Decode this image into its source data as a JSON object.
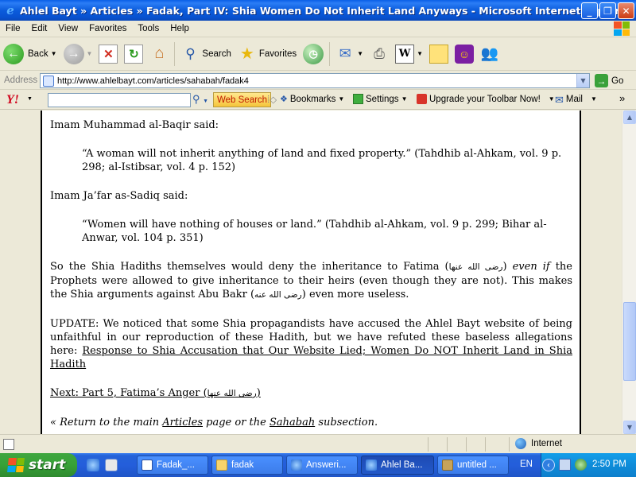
{
  "window": {
    "title": "Ahlel Bayt » Articles » Fadak, Part IV: Shia Women Do Not Inherit Land Anyways - Microsoft Internet Explorer",
    "minimize": "_",
    "maximize": "❐",
    "close": "✕"
  },
  "menu": {
    "items": [
      "File",
      "Edit",
      "View",
      "Favorites",
      "Tools",
      "Help"
    ]
  },
  "toolbar": {
    "back_label": "Back",
    "search_label": "Search",
    "favorites_label": "Favorites"
  },
  "address": {
    "label": "Address",
    "url": "http://www.ahlelbayt.com/articles/sahabah/fadak4",
    "go_label": "Go"
  },
  "yahoo": {
    "logo": "Y!",
    "search_button": "Web Search",
    "bookmarks": "Bookmarks",
    "settings": "Settings",
    "upgrade": "Upgrade your Toolbar Now!",
    "mail": "Mail",
    "more": "»"
  },
  "article": {
    "baqir_intro": "Imam Muhammad al-Baqir said:",
    "baqir_quote": "“A woman will not inherit anything of land and fixed property.” (Tahdhib al-Ahkam, vol. 9 p. 298; al-Istibsar, vol. 4 p. 152)",
    "sadiq_intro": "Imam Ja’far as-Sadiq said:",
    "sadiq_quote": "“Women will have nothing of houses or land.” (Tahdhib al-Ahkam, vol. 9 p. 299; Bihar al-Anwar, vol. 104 p. 351)",
    "p1_a": "So the Shia Hadiths themselves would deny the inheritance to Fatima (",
    "honorific_fatima": "رضی الله عنها",
    "p1_b": ") ",
    "p1_even_if": "even if",
    "p1_c": " the Prophets were allowed to give inheritance to their heirs (even though they are not). This makes the Shia arguments against Abu Bakr (",
    "honorific_abubakr": "رضی الله عنه",
    "p1_d": ") even more useless.",
    "update_text": "UPDATE: We noticed that some Shia propagandists have accused the Ahlel Bayt website of being unfaithful in our reproduction of these Hadith, but we have refuted these baseless allegations here: ",
    "update_link": "Response to Shia Accusation that Our Website Lied; Women Do NOT Inherit Land in Shia Hadith",
    "next_link_a": "Next: Part 5, Fatima’s Anger (",
    "next_link_honorific": "رضی الله عنها",
    "next_link_b": ")",
    "back_a": "« Return to the main ",
    "back_articles": "Articles",
    "back_b": " page or the ",
    "back_sahabah": "Sahabah",
    "back_c": " subsection."
  },
  "status": {
    "zone": "Internet"
  },
  "taskbar": {
    "start_label": "start",
    "tasks": [
      "Fadak_...",
      "fadak",
      "Answeri...",
      "Ahlel Ba...",
      "untitled ..."
    ],
    "language": "EN",
    "clock": "2:50 PM"
  }
}
